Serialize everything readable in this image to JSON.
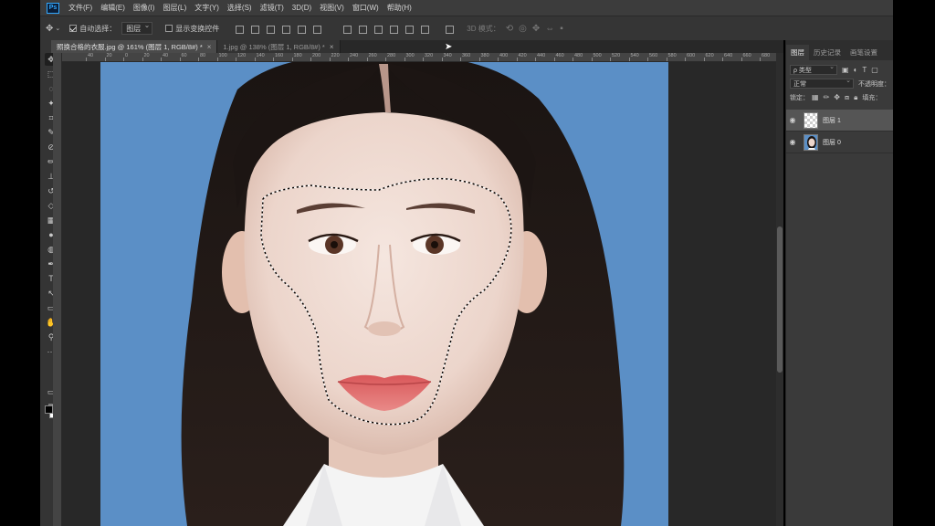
{
  "app": {
    "logo": "Ps"
  },
  "menu": [
    "文件(F)",
    "编辑(E)",
    "图像(I)",
    "图层(L)",
    "文字(Y)",
    "选择(S)",
    "滤镜(T)",
    "3D(D)",
    "视图(V)",
    "窗口(W)",
    "帮助(H)"
  ],
  "options": {
    "move_icon": "move-icon",
    "auto_select_label": "自动选择：",
    "auto_select_checked": true,
    "auto_select_value": "图层",
    "show_transform_label": "显示变换控件",
    "show_transform_checked": false,
    "mode_3d_label": "3D 模式："
  },
  "tabs": [
    {
      "label": "照换合格的衣服.jpg @ 161% (图层 1, RGB/8#) *",
      "active": true
    },
    {
      "label": "1.jpg @ 138% (图层 1, RGB/8#) *",
      "active": false
    }
  ],
  "ruler": {
    "top_numbers": [
      "40",
      "20",
      "0",
      "20",
      "40",
      "60",
      "80",
      "100",
      "120",
      "140",
      "160",
      "180",
      "200",
      "220",
      "240",
      "260",
      "280",
      "300",
      "320",
      "340",
      "360",
      "380",
      "400",
      "420",
      "440",
      "460",
      "480",
      "500",
      "520",
      "540",
      "560",
      "580",
      "600",
      "620",
      "640",
      "660",
      "680",
      "700",
      "720",
      "740"
    ]
  },
  "tools": [
    "move-tool-icon",
    "marquee-tool-icon",
    "lasso-tool-icon",
    "magic-wand-tool-icon",
    "crop-tool-icon",
    "eyedropper-tool-icon",
    "healing-brush-tool-icon",
    "brush-tool-icon",
    "clone-stamp-tool-icon",
    "history-brush-tool-icon",
    "eraser-tool-icon",
    "gradient-tool-icon",
    "blur-tool-icon",
    "dodge-tool-icon",
    "pen-tool-icon",
    "type-tool-icon",
    "path-selection-tool-icon",
    "rectangle-tool-icon",
    "hand-tool-icon",
    "zoom-tool-icon",
    "more-tools-icon"
  ],
  "tool_glyphs": [
    "✥",
    "⬚",
    "◌",
    "✦",
    "⌗",
    "✎",
    "⊘",
    "✏",
    "⊥",
    "↺",
    "◇",
    "▦",
    "●",
    "◍",
    "✒",
    "T",
    "↖",
    "▭",
    "✋",
    "⚲",
    "···"
  ],
  "panel": {
    "tabs": [
      "图层",
      "历史记录",
      "画笔设置"
    ],
    "kind_filter": "ρ 类型",
    "blend_mode": "正常",
    "opacity_label": "不透明度：",
    "lock_label": "锁定：",
    "fill_label": "填充：",
    "layers": [
      {
        "name": "图层 1",
        "selected": true,
        "visible_icon": "eye-icon"
      },
      {
        "name": "图层 0",
        "selected": false,
        "visible_icon": "eye-icon"
      }
    ]
  },
  "colors": {
    "canvas_bg": "#5b8fc6",
    "ps_accent": "#31a8ff",
    "ui_dark": "#353535"
  }
}
